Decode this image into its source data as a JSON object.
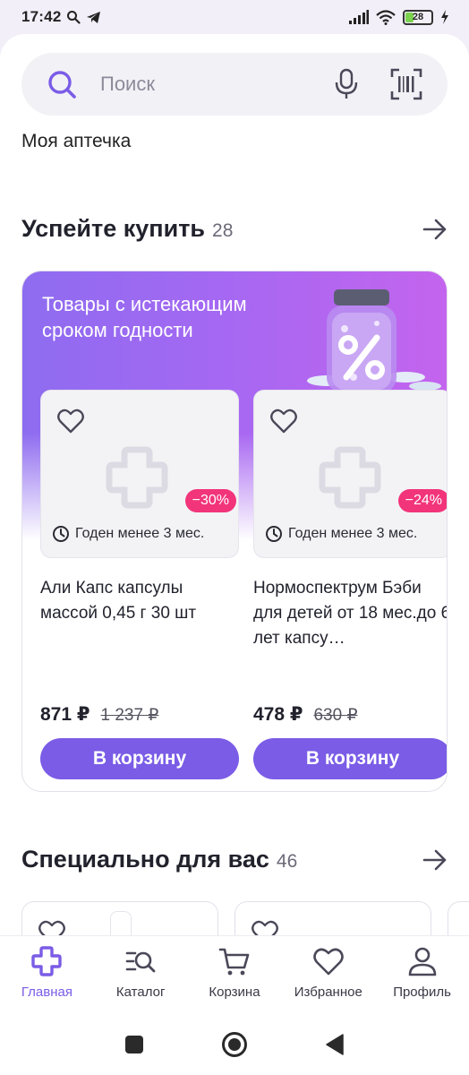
{
  "status_bar": {
    "time": "17:42",
    "battery": "28"
  },
  "search": {
    "placeholder": "Поиск"
  },
  "my_pharmacy": "Моя аптечка",
  "section_expiring": {
    "title": "Успейте купить",
    "count": "28",
    "promo_title": "Товары с истекающим сроком годности",
    "products": [
      {
        "name": "Али Капс капсулы массой 0,45 г 30 шт",
        "discount": "−30%",
        "expiry": "Годен менее 3 мес.",
        "price": "871 ₽",
        "old_price": "1 237 ₽",
        "button": "В корзину"
      },
      {
        "name": "Нормоспектрум Бэби для детей от 18 мес.до 6 лет капсу…",
        "discount": "−24%",
        "expiry": "Годен менее 3 мес.",
        "price": "478 ₽",
        "old_price": "630 ₽",
        "button": "В корзину"
      }
    ]
  },
  "section_for_you": {
    "title": "Специально для вас",
    "count": "46"
  },
  "bottom_nav": [
    {
      "label": "Главная",
      "icon": "home-cross-icon",
      "active": true
    },
    {
      "label": "Каталог",
      "icon": "catalog-search-icon",
      "active": false
    },
    {
      "label": "Корзина",
      "icon": "cart-icon",
      "active": false
    },
    {
      "label": "Избранное",
      "icon": "heart-icon",
      "active": false
    },
    {
      "label": "Профиль",
      "icon": "profile-icon",
      "active": false
    }
  ],
  "colors": {
    "accent": "#7a5ce6",
    "discount": "#f2347a",
    "promo_gradient_start": "#8e6cf0",
    "promo_gradient_end": "#c464ee"
  }
}
